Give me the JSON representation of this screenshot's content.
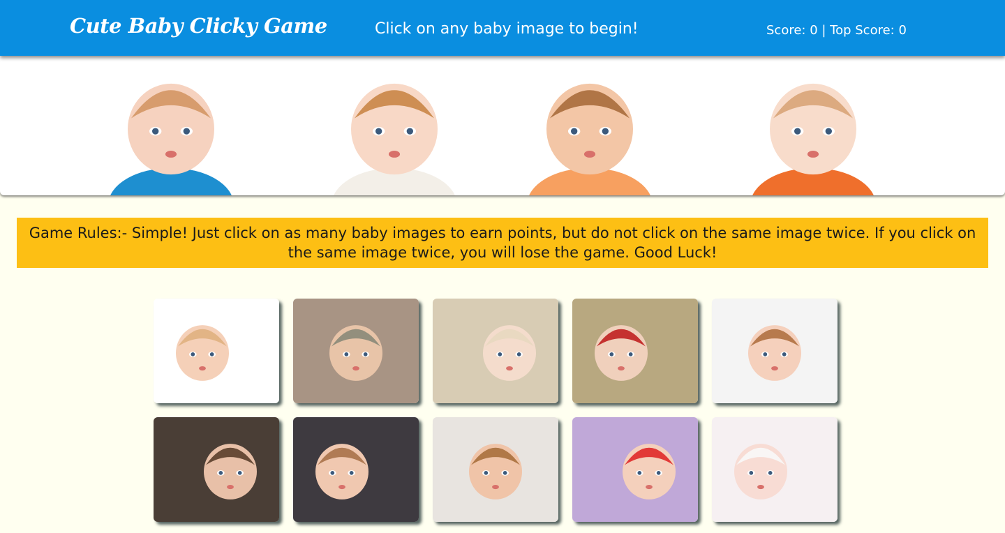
{
  "header": {
    "title": "Cute Baby Clicky Game",
    "message": "Click on any baby image to begin!",
    "score_text": "Score: 0 | Top Score: 0",
    "background_color": "#0a8ee0"
  },
  "hero": {
    "babies": [
      {
        "icon": "baby-in-blue-overalls-image",
        "shirt": "#1e8fd0",
        "skin": "#f6d2bf",
        "hair": "#d49664"
      },
      {
        "icon": "baby-in-white-shirt-image",
        "shirt": "#f3efe8",
        "skin": "#f8d8c6",
        "hair": "#c98646"
      },
      {
        "icon": "baby-in-orange-shirt-image",
        "shirt": "#f7a060",
        "skin": "#f3c6a6",
        "hair": "#a86b3c"
      },
      {
        "icon": "baby-in-orange-pattern-image",
        "shirt": "#ef6f2c",
        "skin": "#f8dccb",
        "hair": "#d8a478"
      }
    ]
  },
  "rules": {
    "text": "Game Rules:- Simple! Just click on as many baby images to earn points, but do not click on the same image twice. If you click on the same image twice, you will lose the game. Good Luck!",
    "background_color": "#fdbf14"
  },
  "cards": [
    {
      "icon": "baby-kissing-face-image",
      "bg": "#ffffff",
      "skin": "#f5d0b8",
      "hair": "#e0b080"
    },
    {
      "icon": "baby-in-knit-hat-image",
      "bg": "#a89484",
      "skin": "#e8c4a8",
      "hair": "#8a8a78"
    },
    {
      "icon": "baby-on-fur-rug-image",
      "bg": "#d8ccb4",
      "skin": "#f4dccc",
      "hair": "#e8d8c0"
    },
    {
      "icon": "baby-in-red-crochet-hat-image",
      "bg": "#b8a880",
      "skin": "#f0d0bc",
      "hair": "#c02020"
    },
    {
      "icon": "girl-with-flowers-image",
      "bg": "#f4f4f4",
      "skin": "#f5d0bc",
      "hair": "#b07040"
    },
    {
      "icon": "toddler-girl-with-bow-image",
      "bg": "#4a3e36",
      "skin": "#e8c0a8",
      "hair": "#5a3e2a"
    },
    {
      "icon": "girl-long-hair-image",
      "bg": "#3e3a40",
      "skin": "#f0c8b0",
      "hair": "#a8724a"
    },
    {
      "icon": "smiling-curly-child-image",
      "bg": "#e8e4e0",
      "skin": "#f0c4a8",
      "hair": "#a8703c"
    },
    {
      "icon": "baby-in-santa-hat-image",
      "bg": "#c0a8d8",
      "skin": "#f4d0bc",
      "hair": "#e02828"
    },
    {
      "icon": "baby-in-white-headband-image",
      "bg": "#f6f0f2",
      "skin": "#f8dcd4",
      "hair": "#f8f8f8"
    }
  ]
}
